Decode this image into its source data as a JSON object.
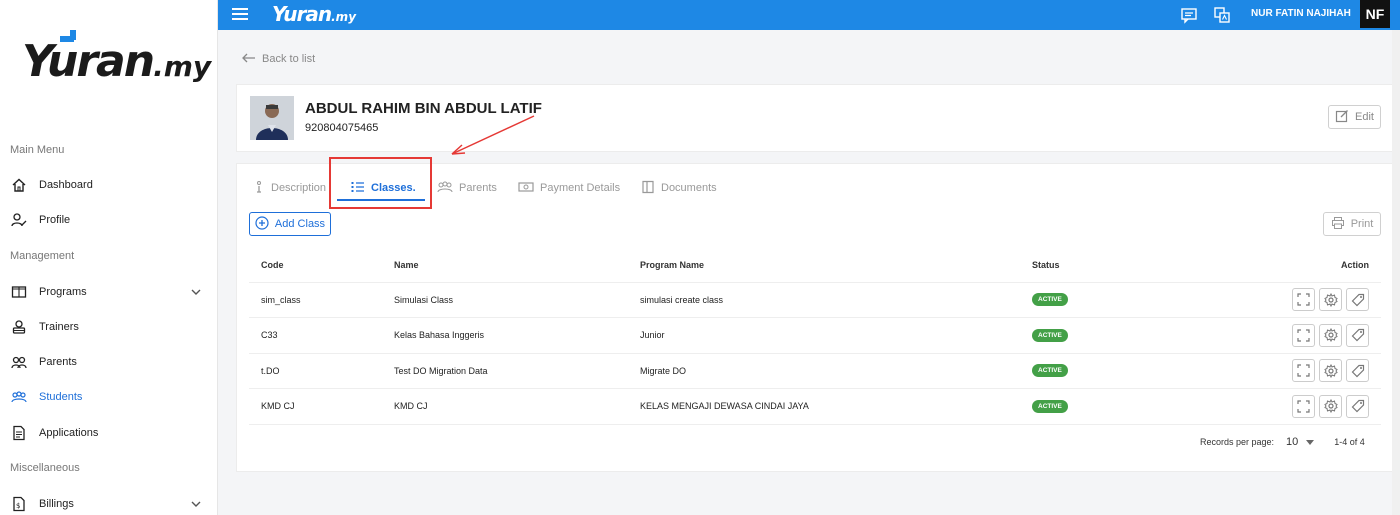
{
  "brand": {
    "logo_main": "Yuran",
    "logo_suffix": ".my",
    "accent": "#1e88e5"
  },
  "sidebar": {
    "sections": {
      "main": "Main Menu",
      "management": "Management",
      "misc": "Miscellaneous"
    },
    "items": [
      {
        "label": "Dashboard",
        "icon": "home-icon"
      },
      {
        "label": "Profile",
        "icon": "user-edit-icon"
      },
      {
        "label": "Programs",
        "icon": "book-open-icon",
        "expandable": true
      },
      {
        "label": "Trainers",
        "icon": "trainer-icon"
      },
      {
        "label": "Parents",
        "icon": "group-icon"
      },
      {
        "label": "Students",
        "icon": "students-icon",
        "active": true
      },
      {
        "label": "Applications",
        "icon": "document-icon"
      },
      {
        "label": "Billings",
        "icon": "billing-icon",
        "expandable": true
      }
    ]
  },
  "topbar": {
    "username": "NUR FATIN NAJIHAH",
    "avatar_initials": "NF"
  },
  "back_label": "Back to list",
  "student": {
    "name": "ABDUL RAHIM BIN ABDUL LATIF",
    "id": "920804075465",
    "edit_label": "Edit"
  },
  "tabs": [
    {
      "label": "Description",
      "icon": "info-icon"
    },
    {
      "label": "Classes.",
      "icon": "list-icon",
      "active": true
    },
    {
      "label": "Parents",
      "icon": "group-icon"
    },
    {
      "label": "Payment Details",
      "icon": "money-icon"
    },
    {
      "label": "Documents",
      "icon": "folder-icon"
    }
  ],
  "buttons": {
    "add_class": "Add Class",
    "print": "Print"
  },
  "table": {
    "headers": [
      "Code",
      "Name",
      "Program Name",
      "Status",
      "Action"
    ],
    "rows": [
      {
        "code": "sim_class",
        "name": "Simulasi Class",
        "program": "simulasi create class",
        "status": "ACTIVE"
      },
      {
        "code": "C33",
        "name": "Kelas Bahasa Inggeris",
        "program": "Junior",
        "status": "ACTIVE"
      },
      {
        "code": "t.DO",
        "name": "Test DO Migration Data",
        "program": "Migrate DO",
        "status": "ACTIVE"
      },
      {
        "code": "KMD CJ",
        "name": "KMD CJ",
        "program": "KELAS MENGAJI DEWASA CINDAI JAYA",
        "status": "ACTIVE"
      }
    ]
  },
  "pagination": {
    "records_label": "Records per page:",
    "per_page": "10",
    "range": "1-4 of 4"
  }
}
